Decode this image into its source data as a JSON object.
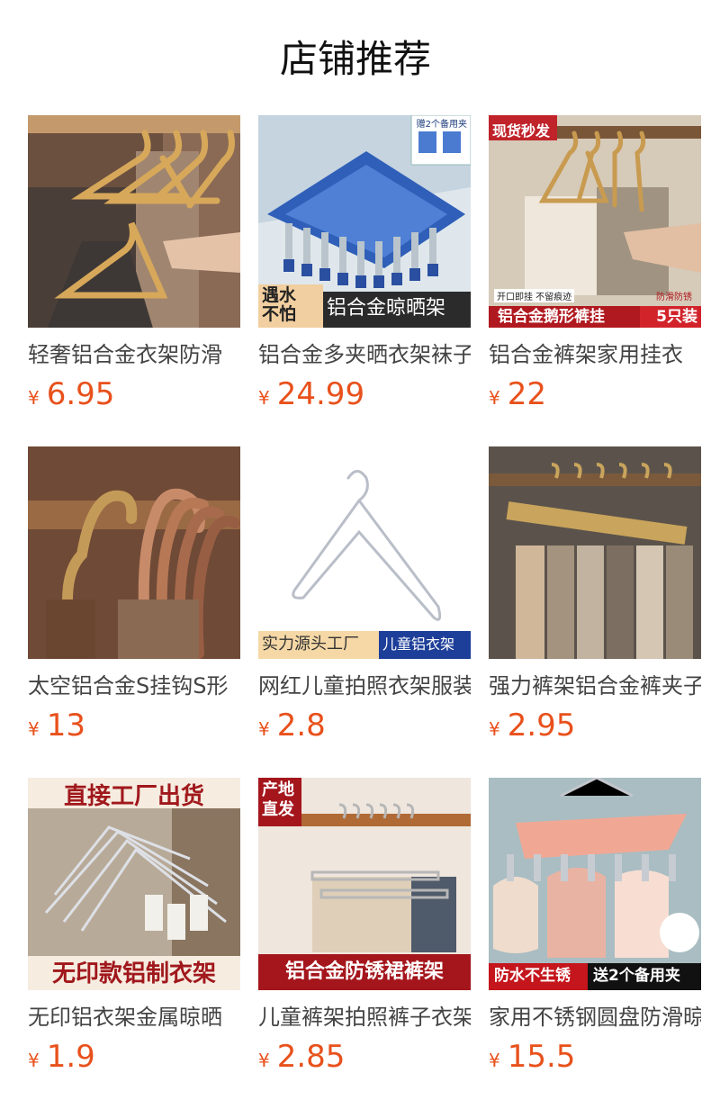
{
  "header": {
    "title": "店铺推荐"
  },
  "products": [
    {
      "name": "轻奢铝合金衣架防滑",
      "price_symbol": "¥",
      "price": "6.95"
    },
    {
      "name": "铝合金多夹晒衣架袜子",
      "price_symbol": "¥",
      "price": "24.99",
      "overlay": {
        "top_right": "赠2个备用夹",
        "left": "遇水不怕",
        "banner": "铝合金晾晒架"
      }
    },
    {
      "name": "铝合金裤架家用挂衣",
      "price_symbol": "¥",
      "price": "22",
      "overlay": {
        "top_left": "现货秒发",
        "small_left": "开口即挂 不留痕迹",
        "small_right": "防滑防锈",
        "banner": "铝合金鹅形裤挂",
        "count": "5只装"
      }
    },
    {
      "name": "太空铝合金S挂钩S形",
      "price_symbol": "¥",
      "price": "13"
    },
    {
      "name": "网红儿童拍照衣架服装",
      "price_symbol": "¥",
      "price": "2.8",
      "overlay": {
        "banner_left": "实力源头工厂",
        "banner_right": "儿童铝衣架"
      }
    },
    {
      "name": "强力裤架铝合金裤夹子",
      "price_symbol": "¥",
      "price": "2.95"
    },
    {
      "name": "无印铝衣架金属晾晒",
      "price_symbol": "¥",
      "price": "1.9",
      "overlay": {
        "top": "直接工厂出货",
        "banner": "无印款铝制衣架"
      }
    },
    {
      "name": "儿童裤架拍照裤子衣架",
      "price_symbol": "¥",
      "price": "2.85",
      "overlay": {
        "top_left": "产地直发",
        "banner": "铝合金防锈裙裤架"
      }
    },
    {
      "name": "家用不锈钢圆盘防滑晾",
      "price_symbol": "¥",
      "price": "15.5",
      "overlay": {
        "banner_left": "防水不生锈",
        "banner_right": "送2个备用夹"
      }
    }
  ],
  "colors": {
    "price": "#e8511c",
    "title": "#111111"
  }
}
